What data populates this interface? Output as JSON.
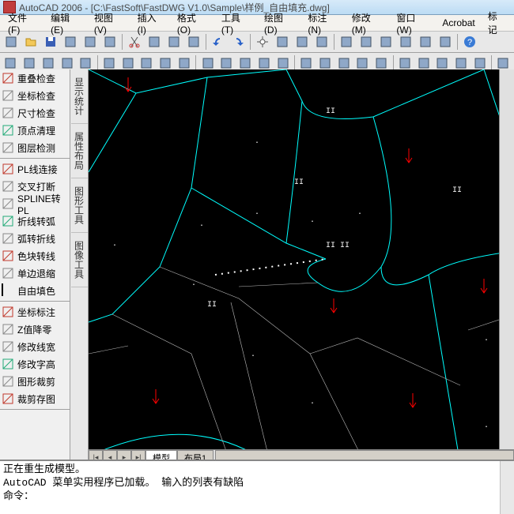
{
  "title": "AutoCAD 2006 - [C:\\FastSoft\\FastDWG V1.0\\Sample\\样例_自由填充.dwg]",
  "menu": [
    "文件(F)",
    "编辑(E)",
    "视图(V)",
    "插入(I)",
    "格式(O)",
    "工具(T)",
    "绘图(D)",
    "标注(N)",
    "修改(M)",
    "窗口(W)",
    "Acrobat",
    "标记"
  ],
  "left_tools": {
    "g1": [
      "重叠检查",
      "坐标检查",
      "尺寸检查",
      "顶点清理",
      "图层检测"
    ],
    "g2": [
      "PL线连接",
      "交叉打断",
      "SPLINE转PL",
      "折线转弧",
      "弧转折线",
      "色块转线",
      "单边退缩",
      "自由填色"
    ],
    "g3": [
      "坐标标注",
      "Z值降零",
      "修改线宽",
      "修改字高",
      "图形裁剪",
      "裁剪存图"
    ]
  },
  "vtabs": [
    "显示统计",
    "属性布局",
    "图形工具",
    "图像工具"
  ],
  "bottom_tabs": {
    "active": "模型",
    "inactive": "布局1"
  },
  "cmd_lines": [
    "正在重生成模型。",
    "AutoCAD 菜单实用程序已加载。 输入的列表有缺陷",
    "命令："
  ],
  "icons": {
    "tb1": [
      "new",
      "open",
      "save",
      "plot",
      "preview",
      "publish",
      "cut",
      "copy",
      "paste",
      "match",
      "undo",
      "redo"
    ],
    "tb2": [
      "pan",
      "zoom-rt",
      "zoom-win",
      "zoom-prev",
      "props",
      "dcenter",
      "tool-pal",
      "sheet",
      "markup",
      "qcalc",
      "help"
    ]
  }
}
